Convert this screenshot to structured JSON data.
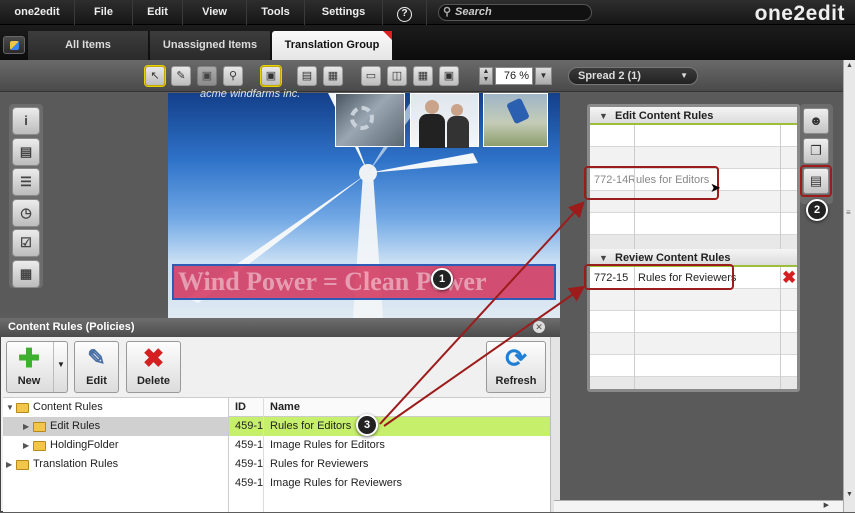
{
  "menubar": {
    "app": "one2edit",
    "items": [
      "File",
      "Edit",
      "View",
      "Tools",
      "Settings"
    ],
    "help": "?",
    "search_placeholder": "Search",
    "logo": "one2edit"
  },
  "tabs": [
    "All Items",
    "Unassigned Items",
    "Translation Group"
  ],
  "toolbar": {
    "zoom": "76 %",
    "spread": "Spread 2 (1)"
  },
  "document": {
    "header_text": "acme windfarms inc.",
    "banner_text": "Wind Power = Clean Power"
  },
  "rules_panel": {
    "edit_title": "Edit Content Rules",
    "edit_rows": [
      {
        "id": "772-14",
        "name": "Rules for Editors"
      }
    ],
    "review_title": "Review Content Rules",
    "review_rows": [
      {
        "id": "772-15",
        "name": "Rules for Reviewers"
      }
    ]
  },
  "dialog": {
    "title": "Content Rules (Policies)",
    "buttons": {
      "new": "New",
      "edit": "Edit",
      "delete": "Delete",
      "refresh": "Refresh"
    },
    "tree": [
      {
        "label": "Content Rules",
        "level": 0
      },
      {
        "label": "Edit Rules",
        "level": 1
      },
      {
        "label": "HoldingFolder",
        "level": 1
      },
      {
        "label": "Translation Rules",
        "level": 0
      }
    ],
    "grid": {
      "headers": [
        "ID",
        "Name"
      ],
      "rows": [
        {
          "id": "459-1",
          "name": "Rules for Editors"
        },
        {
          "id": "459-1",
          "name": "Image Rules for Editors"
        },
        {
          "id": "459-1",
          "name": "Rules for Reviewers"
        },
        {
          "id": "459-1",
          "name": "Image Rules for Reviewers"
        }
      ]
    }
  },
  "callouts": [
    "1",
    "2",
    "3"
  ],
  "colors": {
    "accent_green": "#9bbf3a",
    "selection": "#c6ef6b",
    "highlight": "#9c1c1c",
    "delete_red": "#d42020"
  }
}
